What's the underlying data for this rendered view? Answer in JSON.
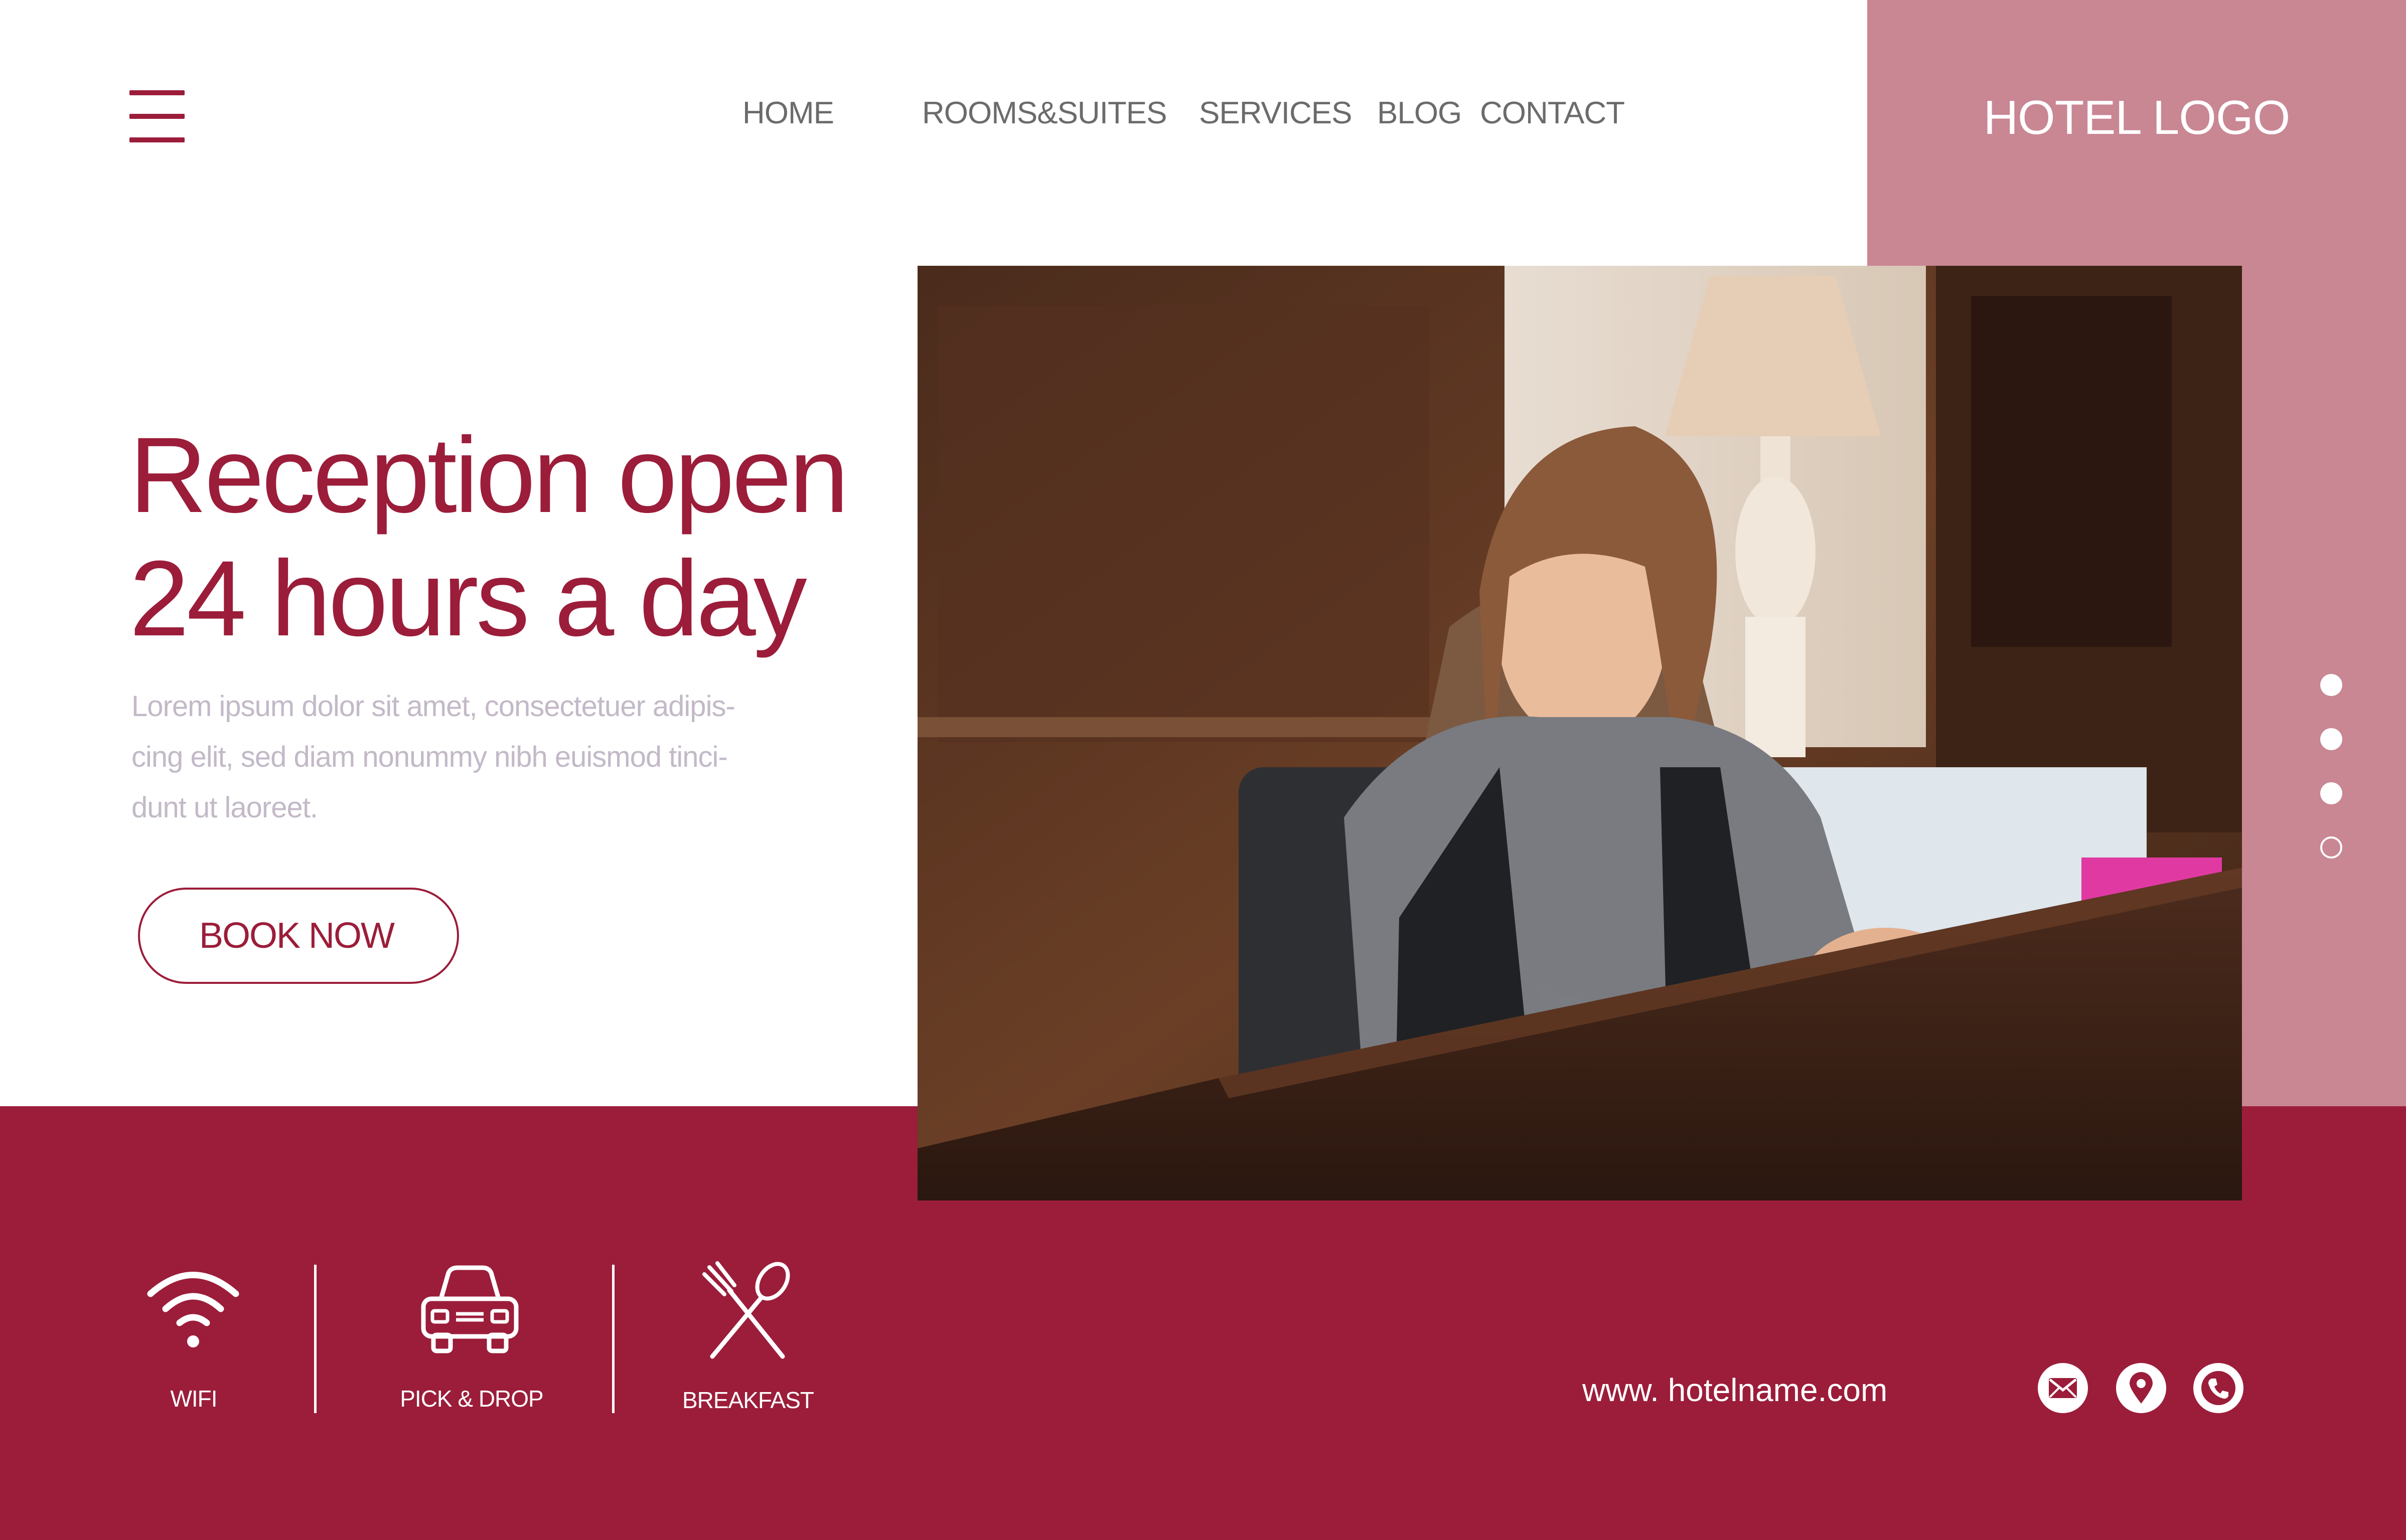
{
  "header": {
    "menu_icon": "hamburger-menu-icon",
    "nav": [
      {
        "label": "HOME"
      },
      {
        "label": "ROOMS&SUITES"
      },
      {
        "label": "SERVICES"
      },
      {
        "label": "BLOG"
      },
      {
        "label": "CONTACT"
      }
    ],
    "logo": "HOTEL LOGO"
  },
  "hero": {
    "title_line1": "Reception open",
    "title_line2": "24 hours a day",
    "description": "Lorem ipsum dolor sit amet, consectetuer adipis- cing elit, sed diam nonummy nibh euismod tinci- dunt ut laoreet.",
    "book_button": "BOOK NOW"
  },
  "slider": {
    "dot_count": 4,
    "active_dots": [
      1,
      2,
      3
    ],
    "current": 4
  },
  "amenities": [
    {
      "label": "WIFI",
      "icon": "wifi-icon"
    },
    {
      "label": "PICK & DROP",
      "icon": "car-icon"
    },
    {
      "label": "BREAKFAST",
      "icon": "fork-spoon-icon"
    }
  ],
  "footer": {
    "website": "www. hotelname.com",
    "contacts": [
      {
        "icon": "mail-icon"
      },
      {
        "icon": "location-pin-icon"
      },
      {
        "icon": "phone-icon"
      }
    ]
  },
  "colors": {
    "primary": "#9b1d3a",
    "accent_panel": "#c98693",
    "nav_text": "#6b6b6b",
    "muted_text": "#c3b9c8",
    "background": "#ffffff"
  }
}
